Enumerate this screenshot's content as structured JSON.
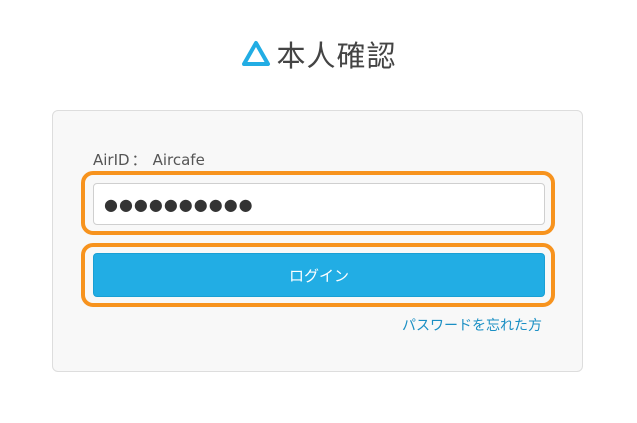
{
  "header": {
    "logo_icon": "airregi-triangle-icon",
    "title": "本人確認"
  },
  "form": {
    "airid_label": "AirID",
    "airid_separator": "：",
    "airid_value": "Aircafe",
    "password_value": "●●●●●●●●●●",
    "login_button": "ログイン",
    "forgot_password_link": "パスワードを忘れた方"
  },
  "colors": {
    "brand": "#22ade4",
    "highlight": "#f7931e",
    "link": "#1a8fc4"
  }
}
